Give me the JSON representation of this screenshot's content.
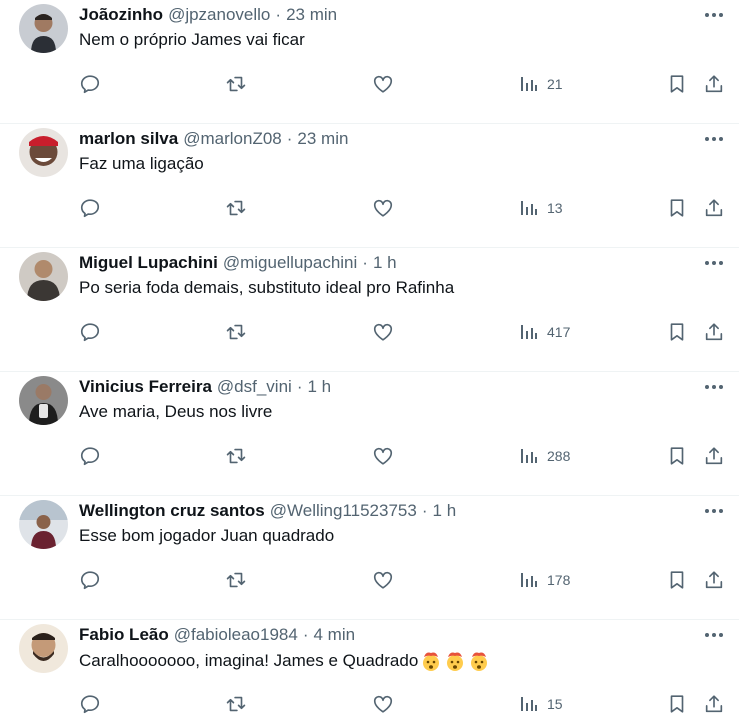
{
  "tweets": [
    {
      "name": "Joãozinho",
      "handle": "@jpzanovello",
      "separator": "·",
      "time": "23 min",
      "text": "Nem o próprio James vai ficar",
      "views": "21",
      "avatar_color": "#7a8088"
    },
    {
      "name": "marlon silva",
      "handle": "@marlonZ08",
      "separator": "·",
      "time": "23 min",
      "text": "Faz uma ligação",
      "views": "13",
      "avatar_color": "#3a2a24"
    },
    {
      "name": "Miguel Lupachini",
      "handle": "@miguellupachini",
      "separator": "·",
      "time": "1 h",
      "text": "Po seria foda demais, substituto ideal pro Rafinha",
      "views": "417",
      "avatar_color": "#b8b2ad"
    },
    {
      "name": "Vinicius Ferreira",
      "handle": "@dsf_vini",
      "separator": "·",
      "time": "1 h",
      "text": "Ave maria, Deus nos livre",
      "views": "288",
      "avatar_color": "#5c5c5c"
    },
    {
      "name": "Wellington cruz santos",
      "handle": "@Welling11523753",
      "separator": "·",
      "time": "1 h",
      "text": "Esse bom jogador Juan quadrado",
      "views": "178",
      "avatar_color": "#c9ccd1"
    },
    {
      "name": "Fabio Leão",
      "handle": "@fabioleao1984",
      "separator": "·",
      "time": "4 min",
      "text": "Caralhooooooo, imagina! James e Quadrado",
      "views": "15",
      "avatar_color": "#d9c2a7",
      "emoji_count": 3,
      "emoji_name": "exploding-head-emoji"
    }
  ],
  "icons": {
    "more": "more-horizontal-icon",
    "reply": "reply-icon",
    "retweet": "retweet-icon",
    "like": "heart-icon",
    "views": "views-chart-icon",
    "bookmark": "bookmark-icon",
    "share": "share-icon"
  },
  "colors": {
    "text": "#0f1419",
    "secondary": "#536471",
    "divider": "#eff3f4"
  }
}
